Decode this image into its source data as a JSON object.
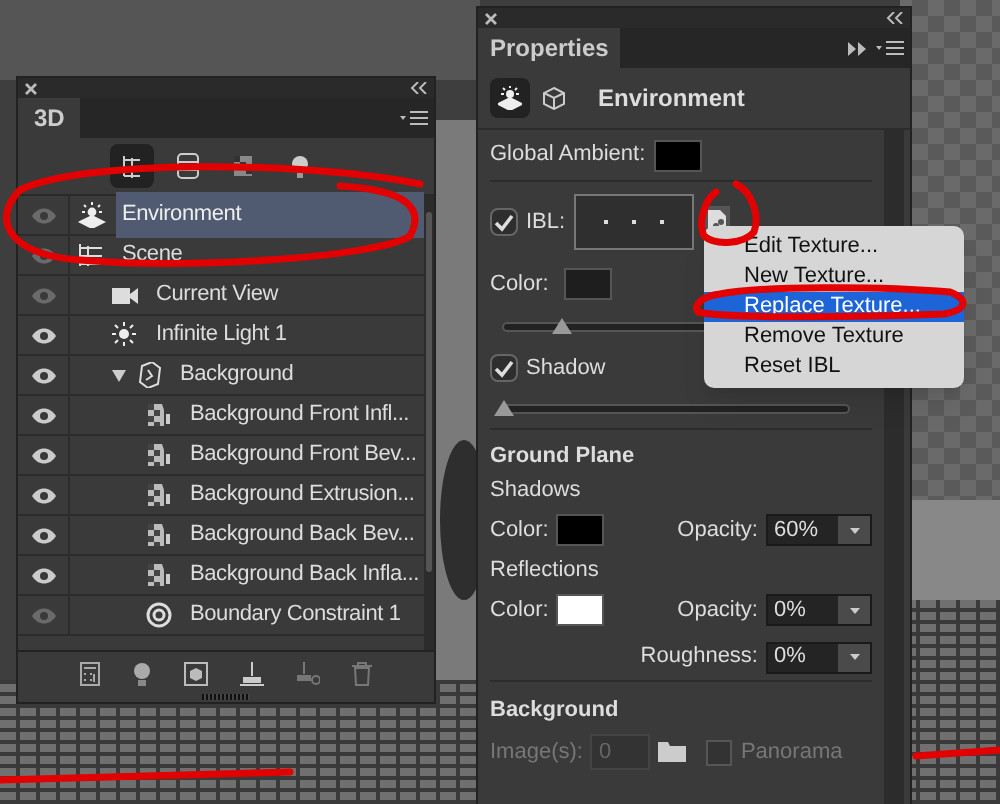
{
  "panel_3d": {
    "title": "3D",
    "filters": [
      {
        "kind": "scene",
        "selected": true
      },
      {
        "kind": "mesh",
        "selected": false
      },
      {
        "kind": "material",
        "selected": false
      },
      {
        "kind": "light",
        "selected": false
      }
    ],
    "layers": [
      {
        "label": "Environment",
        "kind": "environment",
        "visible": false,
        "selected": true
      },
      {
        "label": "Scene",
        "kind": "scene",
        "visible": false,
        "selected": false,
        "expanded": true,
        "children": [
          {
            "label": "Current View",
            "kind": "camera",
            "visible": false,
            "selected": false
          },
          {
            "label": "Infinite Light 1",
            "kind": "light",
            "visible": true,
            "selected": false
          },
          {
            "label": "Background",
            "kind": "mesh",
            "visible": true,
            "selected": false,
            "expanded": true,
            "children": [
              {
                "label": "Background Front Infl...",
                "kind": "material",
                "visible": true,
                "selected": false
              },
              {
                "label": "Background Front Bev...",
                "kind": "material",
                "visible": true,
                "selected": false
              },
              {
                "label": "Background Extrusion...",
                "kind": "material",
                "visible": true,
                "selected": false
              },
              {
                "label": "Background Back Bev...",
                "kind": "material",
                "visible": true,
                "selected": false
              },
              {
                "label": "Background Back Infla...",
                "kind": "material",
                "visible": true,
                "selected": false
              },
              {
                "label": "Boundary Constraint 1",
                "kind": "constraint",
                "visible": false,
                "selected": false
              }
            ]
          }
        ]
      }
    ]
  },
  "properties": {
    "title": "Properties",
    "header": "Environment",
    "global_ambient": {
      "label": "Global Ambient:",
      "color": "#000000"
    },
    "ibl": {
      "label": "IBL:",
      "checked": true
    },
    "color": {
      "label": "Color:",
      "color": "#1e1e1e"
    },
    "intensity": {
      "level": 0.17
    },
    "shadow": {
      "label": "Shadow",
      "checked": true
    },
    "softness": {
      "level": 0.0
    },
    "ground_plane": {
      "title": "Ground Plane",
      "shadows": {
        "title": "Shadows",
        "color_label": "Color:",
        "color": "#000000",
        "opacity_label": "Opacity:",
        "opacity": "60%"
      },
      "reflections": {
        "title": "Reflections",
        "color_label": "Color:",
        "color": "#ffffff",
        "opacity_label": "Opacity:",
        "opacity": "0%",
        "roughness_label": "Roughness:",
        "roughness": "0%"
      }
    },
    "background": {
      "title": "Background",
      "image_label": "Image(s):",
      "image_value": "0",
      "disabled": true,
      "panorama": {
        "label": "Panorama",
        "checked": false
      }
    }
  },
  "texture_menu": [
    {
      "label": "Edit Texture...",
      "selected": false
    },
    {
      "label": "New Texture...",
      "selected": false
    },
    {
      "label": "Replace Texture...",
      "selected": true
    },
    {
      "label": "Remove Texture",
      "selected": false
    },
    {
      "label": "Reset IBL",
      "selected": false
    }
  ]
}
